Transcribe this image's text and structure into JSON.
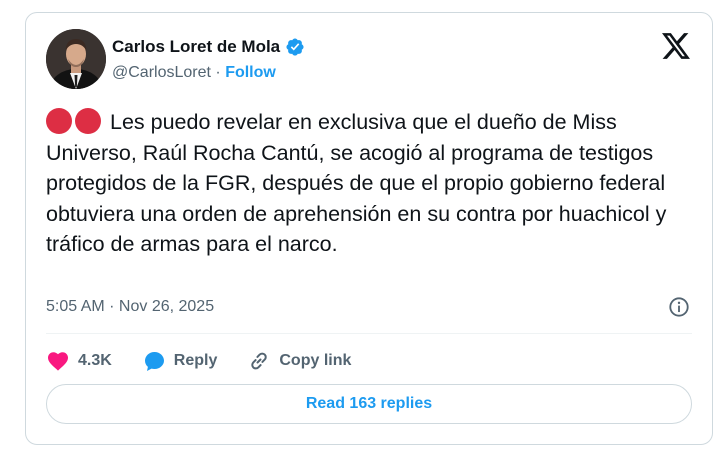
{
  "author": {
    "name": "Carlos Loret de Mola",
    "handle": "@CarlosLoret",
    "separator": "·",
    "follow_label": "Follow",
    "verified": true
  },
  "post": {
    "emoji": [
      "red-circle",
      "red-circle"
    ],
    "text": "Les puedo revelar en exclusiva que el dueño de Miss Universo, Raúl Rocha Cantú, se acogió al programa de testigos protegidos de la FGR, después de que el propio gobierno federal obtuviera una orden de aprehensión en su contra por huachicol y tráfico de armas para el narco.",
    "timestamp": "5:05 AM · Nov 26, 2025"
  },
  "actions": {
    "like_count": "4.3K",
    "reply_label": "Reply",
    "copy_link_label": "Copy link"
  },
  "footer": {
    "read_replies_label": "Read 163 replies"
  },
  "colors": {
    "accent": "#1d9bf0",
    "like": "#f91880",
    "emoji_red": "#dd2e44",
    "text": "#0f1419",
    "muted": "#536471",
    "border": "#cfd9de"
  },
  "icons": [
    "x-logo-icon",
    "verified-badge-icon",
    "info-icon",
    "heart-icon",
    "reply-bubble-icon",
    "link-icon"
  ]
}
